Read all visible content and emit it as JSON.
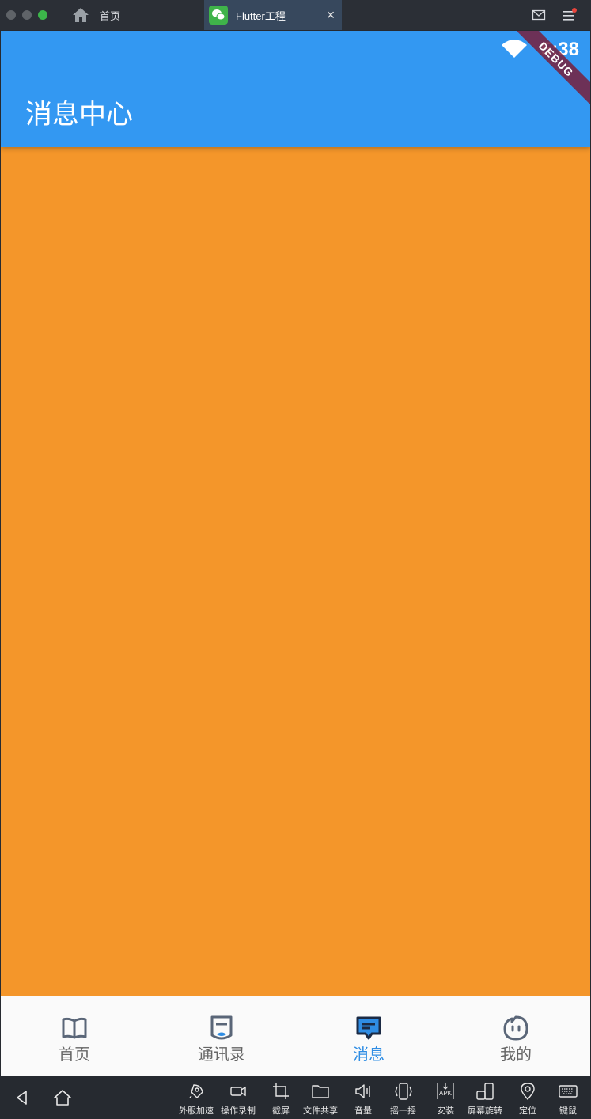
{
  "topbar": {
    "tabs": [
      {
        "label": "首页"
      },
      {
        "label": "Flutter工程"
      }
    ],
    "close_glyph": "×"
  },
  "statusbar": {
    "time": "5:38",
    "debug": "DEBUG"
  },
  "appbar": {
    "title": "消息中心"
  },
  "colors": {
    "appbar": "#3398f2",
    "body": "#f4962a",
    "active": "#2f8de4",
    "inactive": "#666666"
  },
  "bottomnav": {
    "items": [
      {
        "label": "首页",
        "icon": "book-icon",
        "active": false
      },
      {
        "label": "通讯录",
        "icon": "contacts-icon",
        "active": false
      },
      {
        "label": "消息",
        "icon": "message-icon",
        "active": true
      },
      {
        "label": "我的",
        "icon": "face-icon",
        "active": false
      }
    ]
  },
  "emulator_toolbar": {
    "buttons": [
      {
        "label": "外服加速",
        "icon": "rocket-icon"
      },
      {
        "label": "操作录制",
        "icon": "video-icon"
      },
      {
        "label": "截屏",
        "icon": "crop-icon"
      },
      {
        "label": "文件共享",
        "icon": "folder-icon"
      },
      {
        "label": "音量",
        "icon": "volume-icon"
      },
      {
        "label": "摇一摇",
        "icon": "shake-icon"
      },
      {
        "label": "安装",
        "icon": "apk-icon"
      },
      {
        "label": "屏幕旋转",
        "icon": "rotate-icon"
      },
      {
        "label": "定位",
        "icon": "location-icon"
      },
      {
        "label": "键鼠",
        "icon": "keyboard-icon"
      }
    ],
    "apk_text": "APK"
  }
}
